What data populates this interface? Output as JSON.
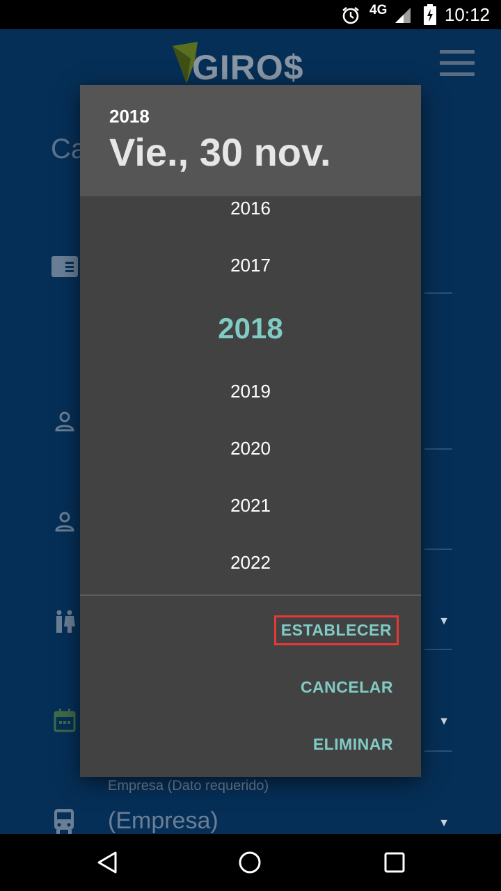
{
  "status_bar": {
    "time": "10:12",
    "network": "4G",
    "icons": [
      "alarm-icon",
      "signal-icon",
      "battery-charging-icon"
    ]
  },
  "app": {
    "logo_text": "GIRO$",
    "title_partial": "Ca",
    "company_field": {
      "label": "Empresa (Dato requerido)",
      "value": "(Empresa)"
    }
  },
  "dialog": {
    "header_year": "2018",
    "header_date": "Vie., 30 nov.",
    "years": [
      "2016",
      "2017",
      "2018",
      "2019",
      "2020",
      "2021",
      "2022"
    ],
    "selected_year": "2018",
    "actions": {
      "set": "ESTABLECER",
      "cancel": "CANCELAR",
      "delete": "ELIMINAR"
    }
  },
  "colors": {
    "accent": "#80cbc4",
    "dialog_bg": "#424242",
    "header_bg": "#555555",
    "app_bg": "#062f57",
    "highlight": "#e53935"
  },
  "nav_bar": {
    "icons": [
      "back-icon",
      "home-icon",
      "recents-icon"
    ]
  }
}
